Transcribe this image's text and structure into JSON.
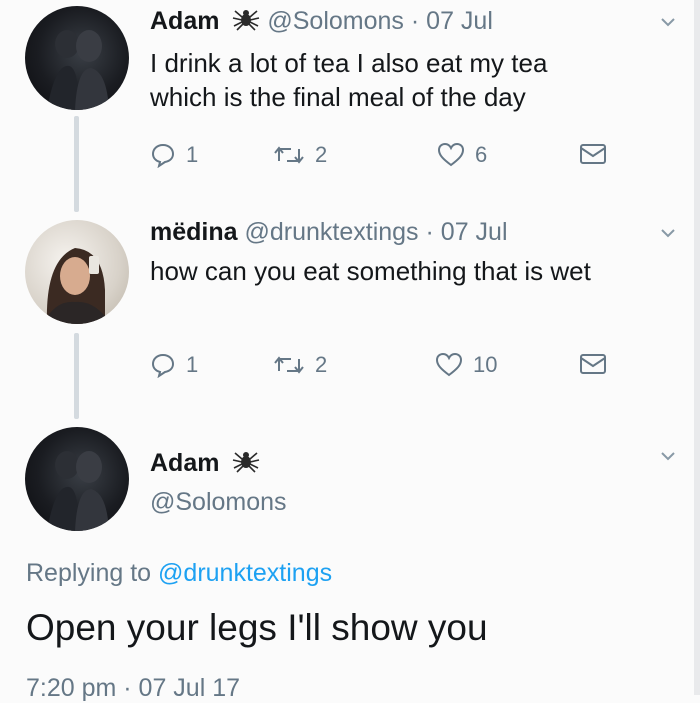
{
  "tweets": [
    {
      "name": "Adam",
      "handle": "@Solomons",
      "date": "· 07 Jul",
      "text_lines": [
        "I drink a lot of tea I also eat my tea",
        "which is the final meal of the day"
      ],
      "reply_count": "1",
      "retweet_count": "2",
      "like_count": "6"
    },
    {
      "name": "mëdina",
      "handle": "@drunktextings",
      "date": "· 07 Jul",
      "text_lines": [
        "how can you eat something that is wet"
      ],
      "reply_count": "1",
      "retweet_count": "2",
      "like_count": "10"
    }
  ],
  "focused": {
    "name": "Adam",
    "handle": "@Solomons",
    "replying_prefix": "Replying to",
    "replying_to": "@drunktextings",
    "text": "Open your legs I'll show you",
    "timestamp": "7:20 pm · 07 Jul 17"
  },
  "colors": {
    "accent": "#1da1f2",
    "muted": "#657786",
    "text": "#14171a"
  },
  "icons": [
    "reply-icon",
    "retweet-icon",
    "like-icon",
    "dm-icon",
    "chevron-down-icon",
    "spider-emoji"
  ]
}
